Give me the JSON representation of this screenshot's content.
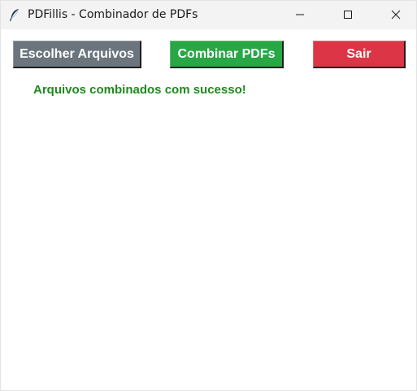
{
  "window": {
    "title": "PDFillis - Combinador de PDFs",
    "icon": "feather-icon",
    "controls": [
      "minimize-icon",
      "maximize-icon",
      "close-icon"
    ]
  },
  "toolbar": {
    "choose_label": "Escolher Arquivos",
    "combine_label": "Combinar PDFs",
    "quit_label": "Sair"
  },
  "status": {
    "message": "Arquivos combinados com sucesso!"
  },
  "colors": {
    "choose_bg": "#6c757d",
    "combine_bg": "#28a745",
    "quit_bg": "#dc3545",
    "status_text": "#1e8a1e"
  }
}
